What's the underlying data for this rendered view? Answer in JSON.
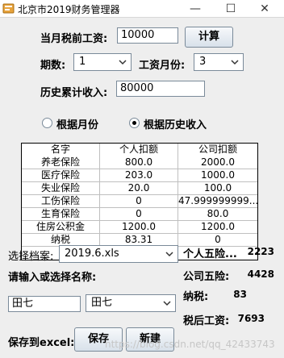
{
  "window": {
    "title": "北京市2019财务管理器",
    "minimize_symbol": "—",
    "maximize_symbol": "☐",
    "close_symbol": "✕"
  },
  "form": {
    "salary_label": "当月税前工资:",
    "salary_value": "10000",
    "calc_button": "计算",
    "period_label": "期数:",
    "period_value": "1",
    "salary_month_label": "工资月份:",
    "salary_month_value": "3",
    "history_label": "历史累计收入:",
    "history_value": "80000",
    "radio_by_month": "根据月份",
    "radio_by_history": "根据历史收入",
    "selected_radio": "by_history"
  },
  "table": {
    "headers": [
      "名字",
      "个人扣额",
      "公司扣额"
    ],
    "rows": [
      [
        "养老保险",
        "800.0",
        "2000.0"
      ],
      [
        "医疗保险",
        "203.0",
        "1000.0"
      ],
      [
        "失业保险",
        "20.0",
        "100.0"
      ],
      [
        "工伤保险",
        "0",
        "47.999999999..."
      ],
      [
        "生育保险",
        "0",
        "80.0"
      ],
      [
        "住房公积金",
        "1200.0",
        "1200.0"
      ],
      [
        "纳税",
        "83.31",
        "0"
      ]
    ]
  },
  "archive": {
    "select_label": "选择档案:",
    "select_value": "2019.6.xls",
    "name_label": "请输入或选择名称:",
    "name_input_value": "田七",
    "name_combo_value": "田七",
    "save_excel_label": "保存到excel:",
    "save_button": "保存",
    "new_button": "新建"
  },
  "summary": {
    "personal_label": "个人五险...",
    "personal_value": "2223",
    "company_label": "公司五险:",
    "company_value": "4428",
    "tax_label": "纳税:",
    "tax_value": "83",
    "net_label": "税后工资:",
    "net_value": "7693"
  },
  "watermark": "https://blog.csdn.net/qq_42433743",
  "colors": {
    "icon_bg": "#e8a33c",
    "border": "#7a8a99",
    "window_bg": "#eeeeee"
  }
}
